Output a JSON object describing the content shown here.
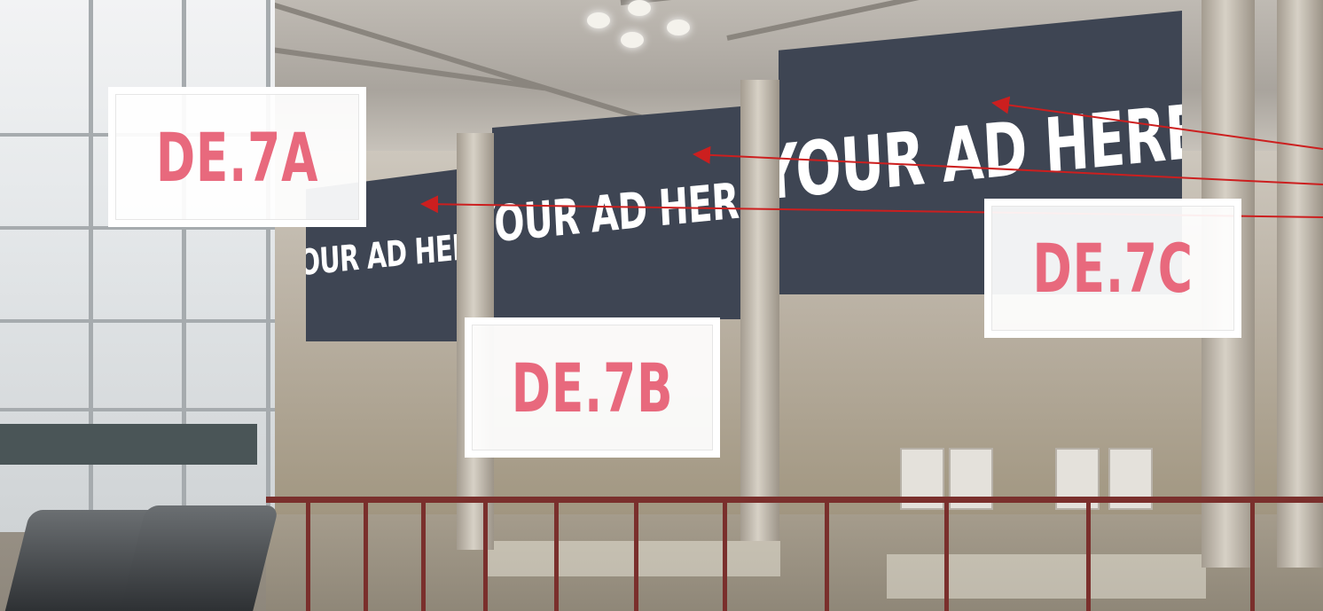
{
  "billboards": [
    {
      "text": "YOUR AD HERE"
    },
    {
      "text": "YOUR AD HERE"
    },
    {
      "text": "YOUR AD HERE"
    }
  ],
  "labels": {
    "a": "DE.7A",
    "b": "DE.7B",
    "c": "DE.7C"
  },
  "colors": {
    "label_text": "#e8697d",
    "billboard": "#3e4553",
    "arrow": "#cc1f1f"
  }
}
